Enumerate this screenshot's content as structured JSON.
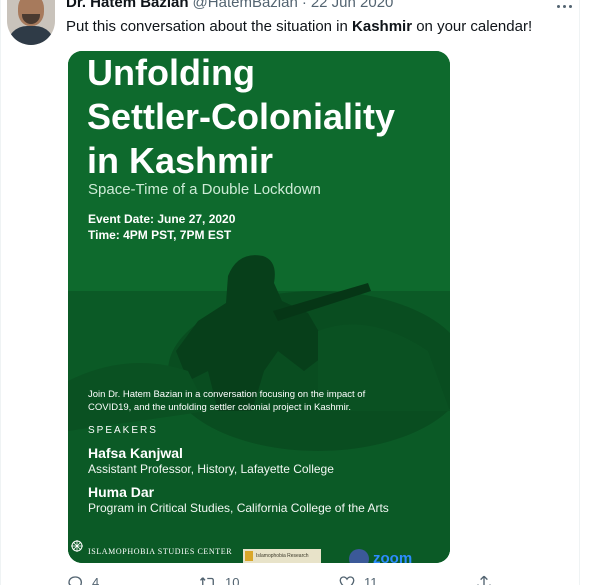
{
  "tweet": {
    "author_name": "Dr. Hatem Bazian",
    "handle": "@HatemBazian",
    "separator": "·",
    "date": "22 Jun 2020",
    "text_before": "Put this conversation about the situation in ",
    "text_bold": "Kashmir",
    "text_after": " on your calendar!"
  },
  "poster": {
    "title_lines": [
      "Unfolding",
      "Settler-Coloniality",
      "in Kashmir"
    ],
    "subtitle": "Space-Time of a Double Lockdown",
    "event_date": "Event Date: June 27, 2020",
    "event_time": "Time: 4PM PST, 7PM EST",
    "description_lines": [
      "Join Dr. Hatem Bazian in a conversation focusing on the impact of",
      "COVID19, and the unfolding settler colonial project in Kashmir."
    ],
    "speakers_label": "SPEAKERS",
    "speakers": [
      {
        "name": "Hafsa Kanjwal",
        "role": "Assistant Professor, History, Lafayette College"
      },
      {
        "name": "Huma Dar",
        "role": "Program in Critical Studies, California College of the Arts"
      }
    ],
    "logo_isc": "ISLAMOPHOBIA STUDIES CENTER",
    "logo_ir": "Islamophobia Research",
    "logo_zoom": "zoom",
    "background_color": "#0e6a2d"
  },
  "actions": {
    "reply_count": "4",
    "retweet_count": "10",
    "like_count": "11"
  },
  "icons": {
    "more": "more-icon",
    "reply": "reply-icon",
    "retweet": "retweet-icon",
    "like": "heart-icon",
    "share": "share-icon"
  },
  "colors": {
    "text_primary": "#0f1419",
    "text_secondary": "#536471"
  }
}
